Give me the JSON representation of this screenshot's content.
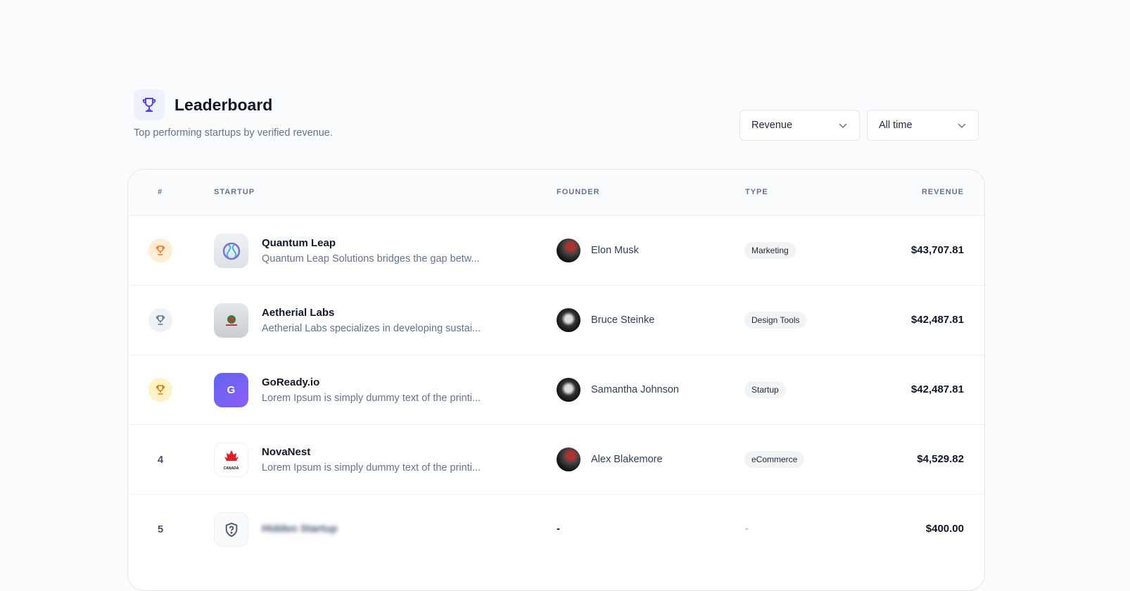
{
  "header": {
    "title": "Leaderboard",
    "subtitle": "Top performing startups by verified revenue.",
    "icon": "trophy-icon"
  },
  "filters": {
    "metric": "Revenue",
    "period": "All time"
  },
  "table": {
    "columns": [
      "#",
      "STARTUP",
      "FOUNDER",
      "TYPE",
      "REVENUE"
    ],
    "rows": [
      {
        "rank": "1",
        "name": "Quantum Leap",
        "desc": "Quantum Leap Solutions bridges the gap betw...",
        "founder": "Elon Musk",
        "type": "Marketing",
        "revenue": "$43,707.81"
      },
      {
        "rank": "2",
        "name": "Aetherial Labs",
        "desc": "Aetherial Labs specializes in developing sustai...",
        "founder": "Bruce Steinke",
        "type": "Design Tools",
        "revenue": "$42,487.81"
      },
      {
        "rank": "3",
        "name": "GoReady.io",
        "logo_letter": "G",
        "desc": "Lorem Ipsum is simply dummy text of the printi...",
        "founder": "Samantha Johnson",
        "type": "Startup",
        "revenue": "$42,487.81"
      },
      {
        "rank": "4",
        "name": "NovaNest",
        "logo_text": "CANADA",
        "desc": "Lorem Ipsum is simply dummy text of the printi...",
        "founder": "Alex Blakemore",
        "type": "eCommerce",
        "revenue": "$4,529.82"
      },
      {
        "rank": "5",
        "name": "Hidden Startup",
        "founder": "-",
        "type": "-",
        "revenue": "$400.00"
      }
    ]
  },
  "colors": {
    "gold": "#f97316",
    "silver": "#64748b",
    "bronze": "#d97706",
    "accent": "#4f46e5"
  }
}
